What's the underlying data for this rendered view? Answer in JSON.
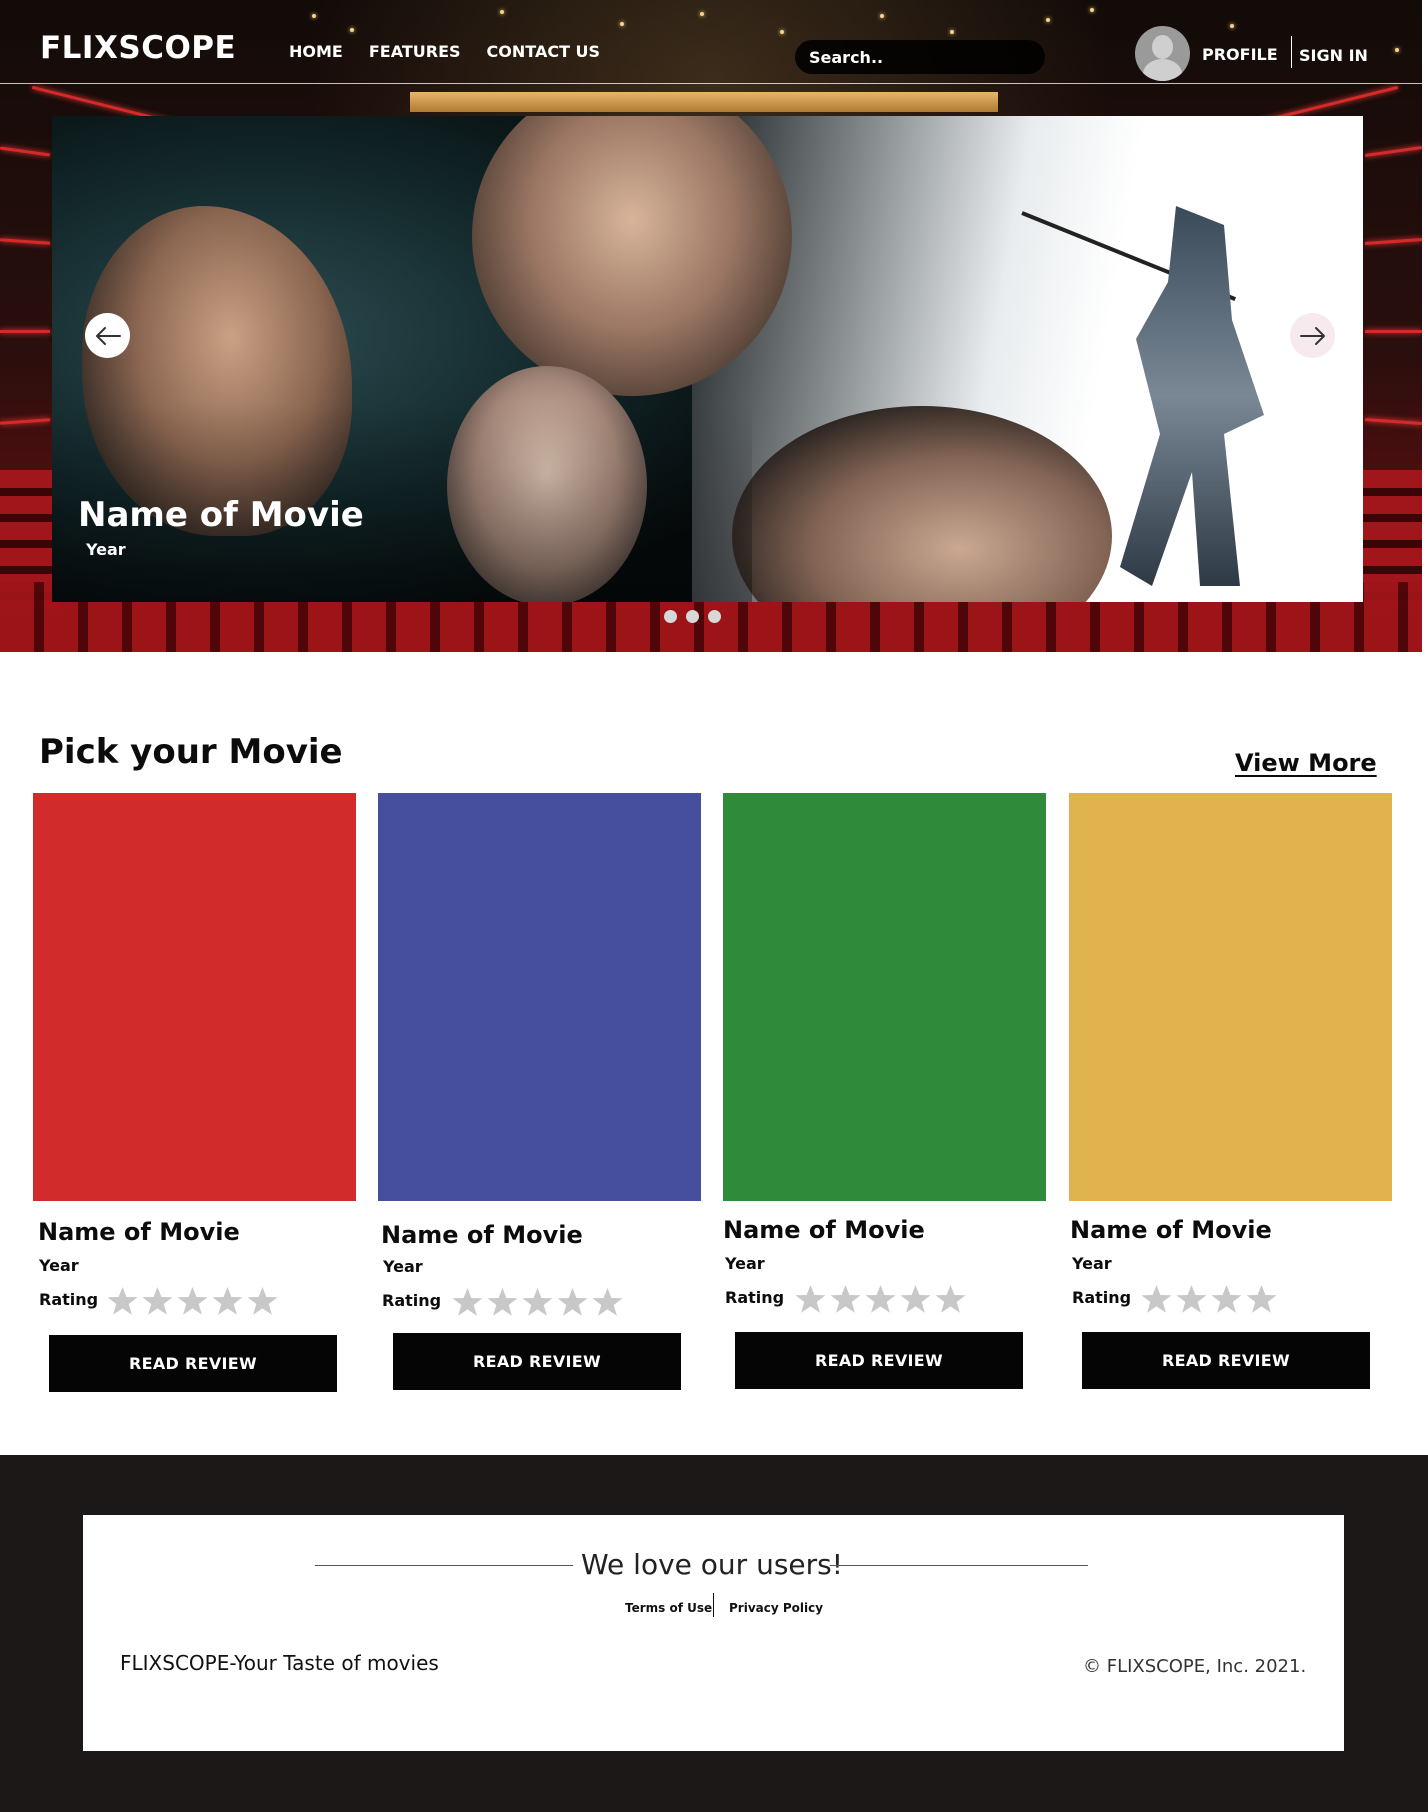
{
  "header": {
    "brand": "FLIXSCOPE",
    "nav": [
      "HOME",
      "FEATURES",
      "CONTACT US"
    ],
    "search_placeholder": "Search..",
    "profile_label": "PROFILE",
    "signin_label": "SIGN IN"
  },
  "carousel": {
    "title": "Name of Movie",
    "year": "Year",
    "slide_count": 3,
    "prev_icon": "arrow-left-icon",
    "next_icon": "arrow-right-icon"
  },
  "movies": {
    "heading": "Pick your Movie",
    "view_more": "View More",
    "rating_label": "Rating",
    "review_label": "READ REVIEW",
    "items": [
      {
        "title": "Name of Movie",
        "year": "Year",
        "poster_color": "#d22b2b",
        "stars": 5
      },
      {
        "title": "Name of Movie",
        "year": "Year",
        "poster_color": "#454f9d",
        "stars": 5
      },
      {
        "title": "Name of Movie",
        "year": "Year",
        "poster_color": "#2f8a3a",
        "stars": 5
      },
      {
        "title": "Name of Movie",
        "year": "Year",
        "poster_color": "#e0b34e",
        "stars": 4
      }
    ]
  },
  "footer": {
    "tagline": "We love our users!",
    "terms": "Terms of Use",
    "privacy": "Privacy Policy",
    "brand_line": "FLIXSCOPE-Your Taste of movies",
    "copyright": "© FLIXSCOPE, Inc. 2021."
  },
  "colors": {
    "button": "#050505",
    "footer_bg": "#1c1818",
    "star": "#c8c8c8"
  }
}
